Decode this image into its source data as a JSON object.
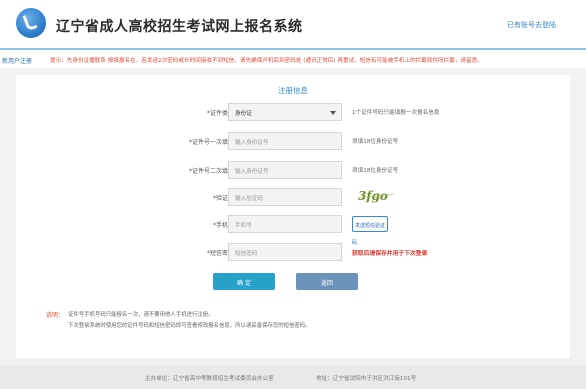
{
  "header": {
    "title": "辽宁省成人高校招生考试网上报名系统",
    "login_link": "已有账号去登陆"
  },
  "notice": {
    "title": "新用户注册",
    "text": "提示：先身份证播联系 报填报名在，若发送2次密码或长时间接收不到短信，请先确保开机后到密码处 (通讯正常后) 再重试，短信有可能被手机上的拦截软件所拦截，请留意。"
  },
  "form": {
    "title": "注册信息",
    "id_type": {
      "label": "*证件类型",
      "value": "身份证",
      "hint": "1个证件号码只能填报一次报名信息"
    },
    "id_number": {
      "label": "*证件号一次填入",
      "placeholder": "输入身份证号",
      "hint": "须填18位身份证号"
    },
    "id_number_confirm": {
      "label": "*证件号二次填入",
      "placeholder": "输入身份证号",
      "hint": "须填18位身份证号"
    },
    "captcha": {
      "label": "*验证码",
      "placeholder": "输入验证码",
      "code": "3fgo"
    },
    "phone": {
      "label": "*手机号",
      "placeholder": "手机号",
      "send_button": "发送短信验证"
    },
    "sms_code": {
      "label": "*短信密码",
      "placeholder": "短信密码",
      "hint_top": "码",
      "hint": "获取后请保存并用于下次登录"
    },
    "buttons": {
      "ok": "确 定",
      "back": "返回"
    }
  },
  "tips": {
    "label": "说明：",
    "line1": "证件号手机号码只能报名一次，请不要用他人手机进行注册。",
    "line2": "下次登录系统时使用您的证件号码和短信密码即可查看修改报名信息，所以请妥善保存您的短信密码。"
  },
  "footer": {
    "sponsor": "主办单位：辽宁省高中等教育招生考试委员会办公室",
    "address": "地址：辽宁省沈阳市于洪区洪江街101号"
  },
  "colors": {
    "accent": "#3a87c8",
    "warning": "#e04b37",
    "primary_button": "#27a1c8",
    "secondary_button": "#6b92ba"
  }
}
